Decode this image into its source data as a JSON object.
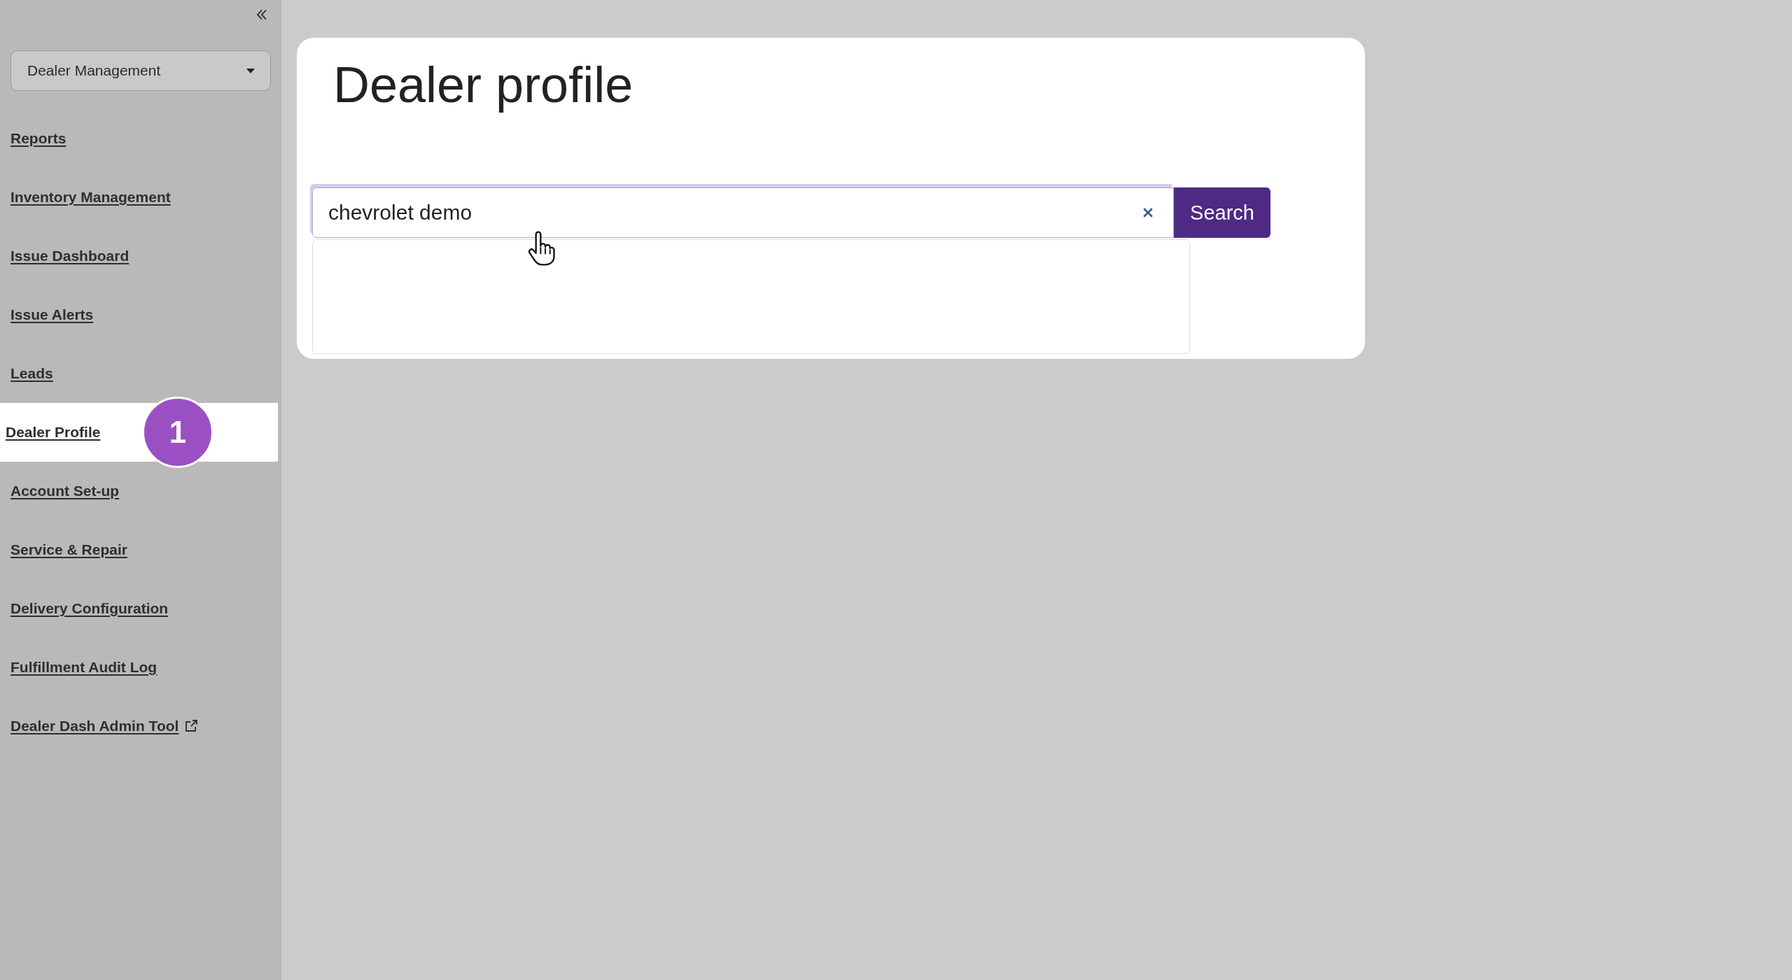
{
  "sidebar": {
    "dropdown": {
      "value": "Dealer Management"
    },
    "items": [
      {
        "label": "Reports",
        "selected": false,
        "external": false
      },
      {
        "label": "Inventory Management",
        "selected": false,
        "external": false
      },
      {
        "label": "Issue Dashboard",
        "selected": false,
        "external": false
      },
      {
        "label": "Issue Alerts",
        "selected": false,
        "external": false
      },
      {
        "label": "Leads",
        "selected": false,
        "external": false
      },
      {
        "label": "Dealer Profile",
        "selected": true,
        "external": false,
        "badge": "1"
      },
      {
        "label": "Account Set-up",
        "selected": false,
        "external": false
      },
      {
        "label": "Service & Repair",
        "selected": false,
        "external": false
      },
      {
        "label": "Delivery Configuration",
        "selected": false,
        "external": false
      },
      {
        "label": "Fulfillment Audit Log",
        "selected": false,
        "external": false
      },
      {
        "label": "Dealer Dash Admin Tool",
        "selected": false,
        "external": true
      }
    ]
  },
  "main": {
    "title": "Dealer profile",
    "search": {
      "value": "chevrolet demo",
      "button": "Search",
      "suggestions_open": true
    }
  }
}
